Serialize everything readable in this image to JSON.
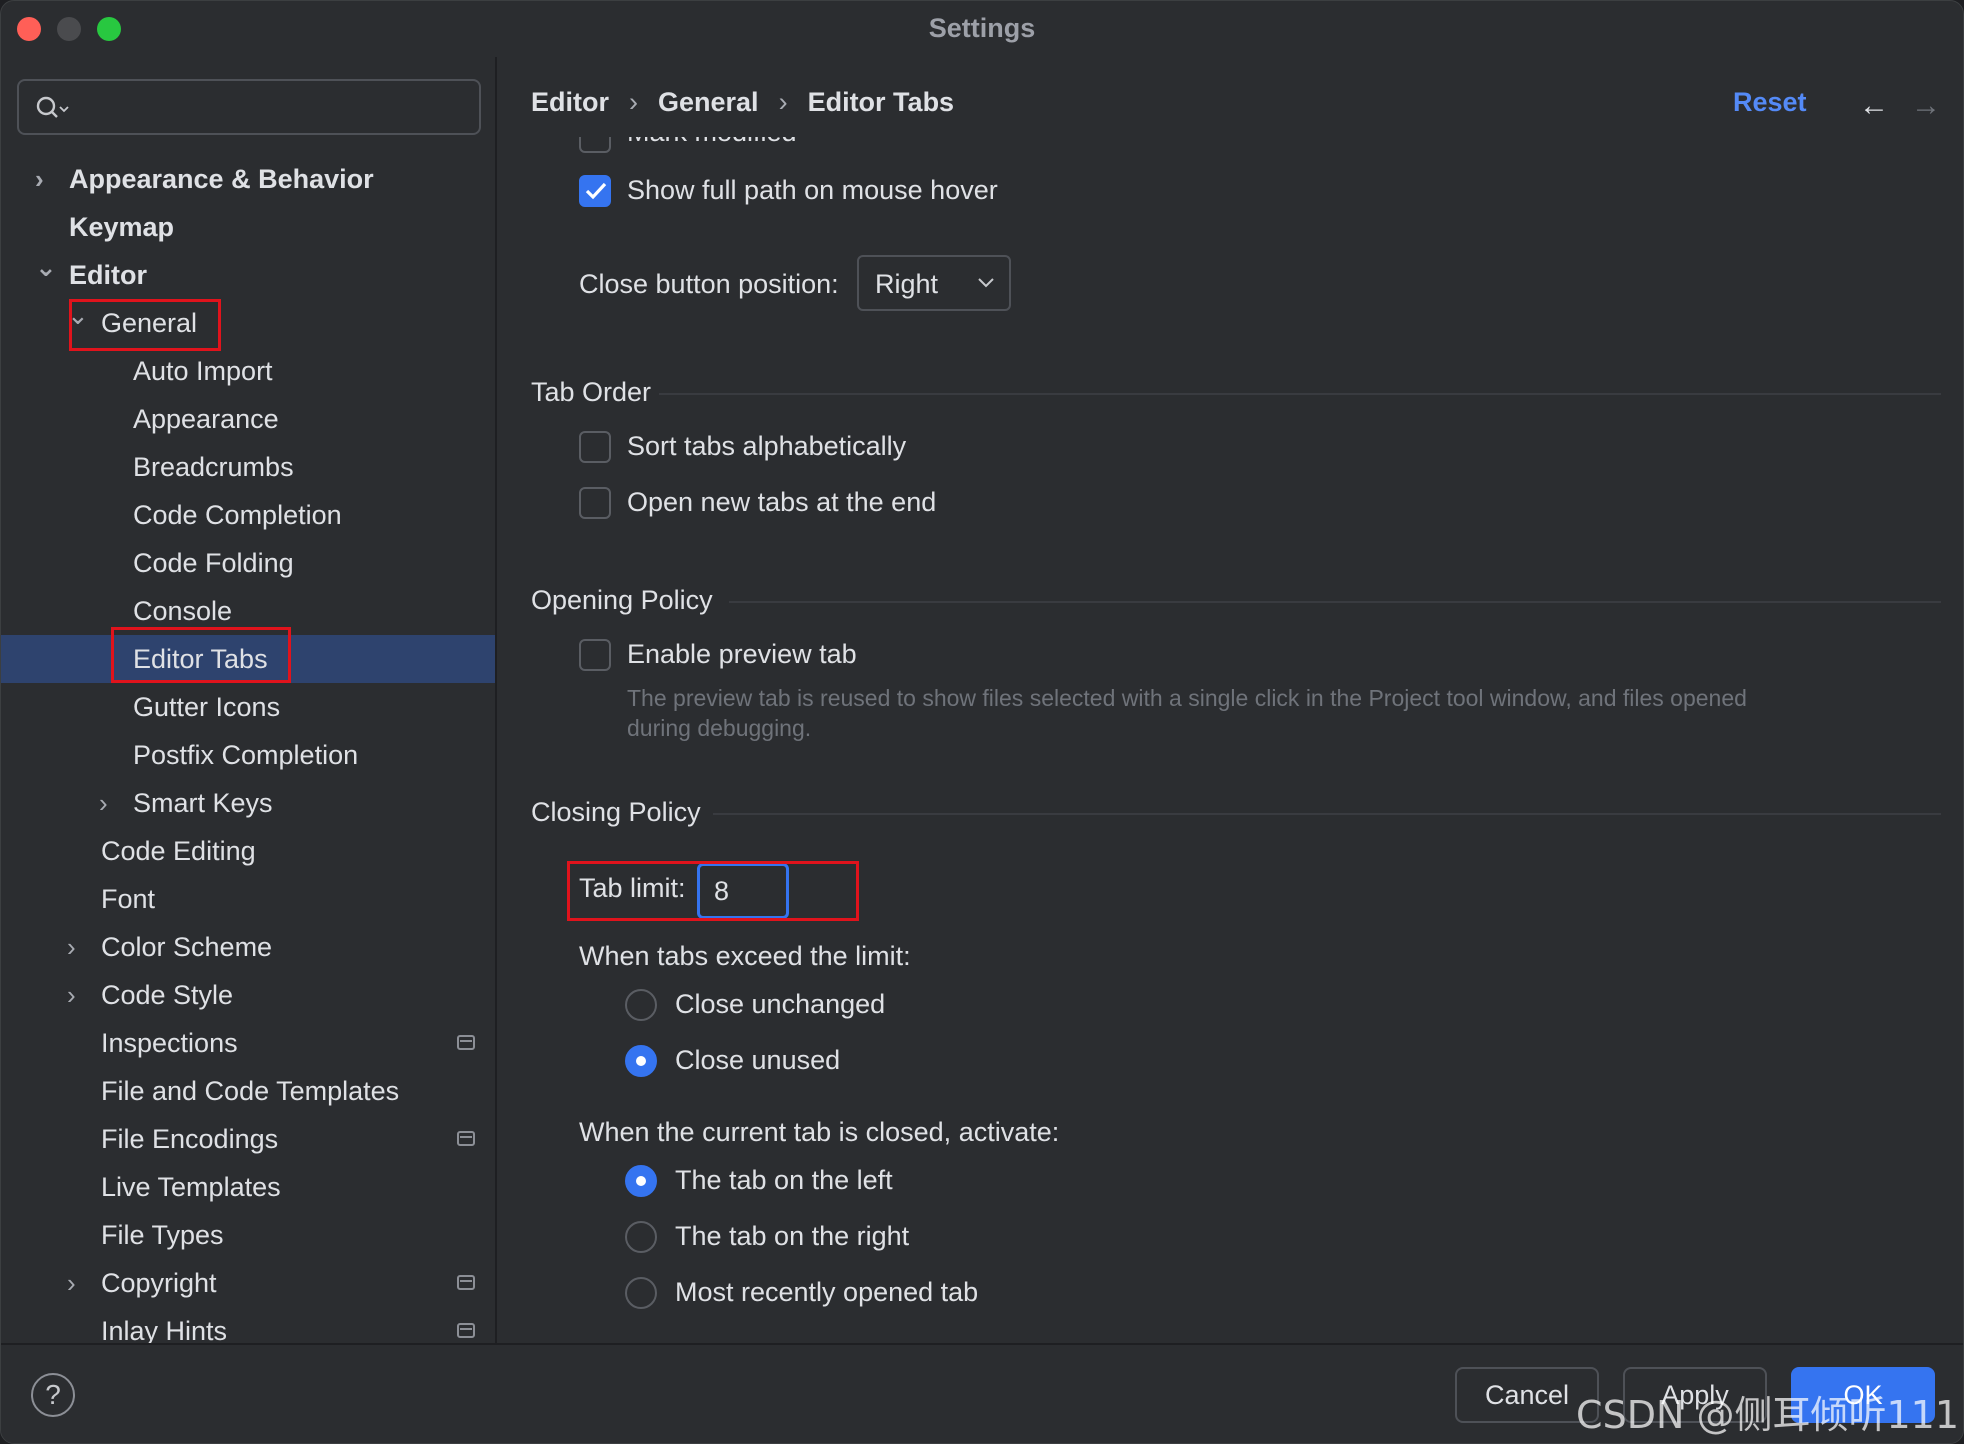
{
  "window": {
    "title": "Settings"
  },
  "sidebar": {
    "search": {
      "placeholder": "",
      "icon": "search-icon"
    },
    "items": [
      {
        "label": "Appearance & Behavior",
        "bold": true,
        "chevron": "collapsed"
      },
      {
        "label": "Keymap",
        "bold": true
      },
      {
        "label": "Editor",
        "bold": true,
        "chevron": "expanded"
      },
      {
        "label": "General",
        "chevron": "expanded",
        "highlighted": true
      },
      {
        "label": "Auto Import"
      },
      {
        "label": "Appearance"
      },
      {
        "label": "Breadcrumbs"
      },
      {
        "label": "Code Completion"
      },
      {
        "label": "Code Folding"
      },
      {
        "label": "Console"
      },
      {
        "label": "Editor Tabs",
        "selected": true,
        "highlighted": true
      },
      {
        "label": "Gutter Icons"
      },
      {
        "label": "Postfix Completion"
      },
      {
        "label": "Smart Keys",
        "chevron": "collapsed"
      },
      {
        "label": "Code Editing"
      },
      {
        "label": "Font"
      },
      {
        "label": "Color Scheme",
        "chevron": "collapsed"
      },
      {
        "label": "Code Style",
        "chevron": "collapsed"
      },
      {
        "label": "Inspections",
        "pin": true
      },
      {
        "label": "File and Code Templates"
      },
      {
        "label": "File Encodings",
        "pin": true
      },
      {
        "label": "Live Templates"
      },
      {
        "label": "File Types"
      },
      {
        "label": "Copyright",
        "chevron": "collapsed",
        "pin": true
      },
      {
        "label": "Inlay Hints",
        "pin": true
      }
    ]
  },
  "header": {
    "breadcrumbs": [
      "Editor",
      "General",
      "Editor Tabs"
    ],
    "reset_label": "Reset",
    "back_icon": "arrow-left-icon",
    "forward_icon": "arrow-right-icon"
  },
  "settings": {
    "mark_modified_label": "Mark modified",
    "show_full_path": {
      "label": "Show full path on mouse hover",
      "checked": true
    },
    "close_button_position": {
      "label": "Close button position:",
      "value": "Right"
    },
    "tab_order": {
      "title": "Tab Order",
      "sort_alphabetically": {
        "label": "Sort tabs alphabetically",
        "checked": false
      },
      "open_at_end": {
        "label": "Open new tabs at the end",
        "checked": false
      }
    },
    "opening_policy": {
      "title": "Opening Policy",
      "enable_preview": {
        "label": "Enable preview tab",
        "checked": false
      },
      "description": "The preview tab is reused to show files selected with a single click in the Project tool window, and files opened during debugging."
    },
    "closing_policy": {
      "title": "Closing Policy",
      "tab_limit_label": "Tab limit:",
      "tab_limit_value": "8",
      "exceed_label": "When tabs exceed the limit:",
      "exceed_options": [
        {
          "label": "Close unchanged",
          "selected": false
        },
        {
          "label": "Close unused",
          "selected": true
        }
      ],
      "activate_label": "When the current tab is closed, activate:",
      "activate_options": [
        {
          "label": "The tab on the left",
          "selected": true
        },
        {
          "label": "The tab on the right",
          "selected": false
        },
        {
          "label": "Most recently opened tab",
          "selected": false
        }
      ]
    }
  },
  "footer": {
    "help_label": "?",
    "cancel_label": "Cancel",
    "apply_label": "Apply",
    "ok_label": "OK",
    "watermark": "CSDN @侧耳倾听111"
  },
  "colors": {
    "accent": "#3574f0",
    "selection": "#2e436e",
    "annotation_box": "#e0131c",
    "link": "#548af7"
  }
}
